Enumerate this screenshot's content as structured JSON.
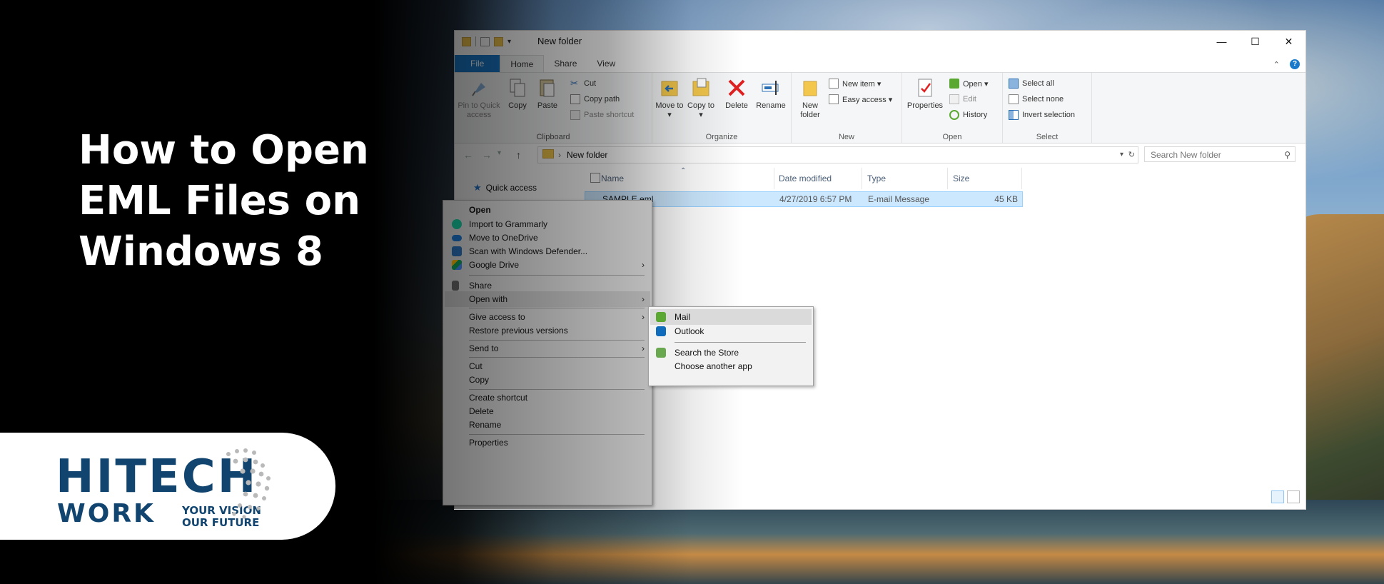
{
  "headline": {
    "line1": "How to Open",
    "line2": "EML Files on",
    "line3": "Windows 8"
  },
  "logo": {
    "hi": "HITECH",
    "work": "WORK",
    "tagline1": "YOUR VISION",
    "tagline2": "OUR FUTURE",
    "brand_color": "#11456f"
  },
  "window": {
    "title": "New folder",
    "controls": {
      "minimize": "—",
      "maximize": "☐",
      "close": "✕"
    },
    "tabs": [
      "File",
      "Home",
      "Share",
      "View"
    ],
    "active_tab": "Home",
    "ribbon": {
      "clipboard": {
        "label": "Clipboard",
        "pin": "Pin to Quick access",
        "copy": "Copy",
        "paste": "Paste",
        "cut": "Cut",
        "copy_path": "Copy path",
        "paste_shortcut": "Paste shortcut"
      },
      "organize": {
        "label": "Organize",
        "move_to": "Move to ▾",
        "copy_to": "Copy to ▾",
        "delete": "Delete",
        "rename": "Rename"
      },
      "new": {
        "label": "New",
        "new_folder": "New folder",
        "new_item": "New item ▾",
        "easy_access": "Easy access ▾"
      },
      "open": {
        "label": "Open",
        "properties": "Properties",
        "open": "Open ▾",
        "edit": "Edit",
        "history": "History"
      },
      "select": {
        "label": "Select",
        "select_all": "Select all",
        "select_none": "Select none",
        "invert_selection": "Invert selection"
      }
    },
    "address": {
      "path": "New folder",
      "search_placeholder": "Search New folder"
    },
    "columns": [
      "Name",
      "Date modified",
      "Type",
      "Size"
    ],
    "sidebar": {
      "quick_access": "Quick access"
    },
    "files": [
      {
        "name": "SAMPLE.eml",
        "date": "4/27/2019 6:57 PM",
        "type": "E-mail Message",
        "size": "45 KB"
      }
    ]
  },
  "context_menu": {
    "open": "Open",
    "grammarly": "Import to Grammarly",
    "onedrive": "Move to OneDrive",
    "defender": "Scan with Windows Defender...",
    "google_drive": "Google Drive",
    "share": "Share",
    "open_with": "Open with",
    "give_access": "Give access to",
    "restore": "Restore previous versions",
    "send_to": "Send to",
    "cut": "Cut",
    "copy": "Copy",
    "create_shortcut": "Create shortcut",
    "delete": "Delete",
    "rename": "Rename",
    "properties": "Properties"
  },
  "submenu": {
    "mail": "Mail",
    "outlook": "Outlook",
    "store": "Search the Store",
    "choose": "Choose another app"
  }
}
